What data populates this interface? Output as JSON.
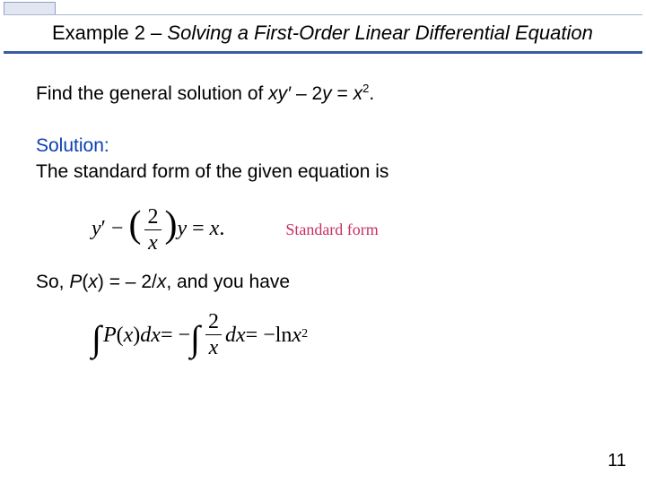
{
  "title": {
    "prefix": "Example 2 –",
    "sub": "Solving a First-Order Linear Differential Equation"
  },
  "prompt": {
    "lead": "Find the general solution of ",
    "lhs1": "xy",
    "prime": "′",
    "mid": " – 2",
    "yv": "y",
    "eq": " = ",
    "xv": "x",
    "exp": "2",
    "dot": "."
  },
  "solution": {
    "label": "Solution:",
    "line1": "The standard form of the given equation is"
  },
  "eq1": {
    "y": "y",
    "prime": "′",
    "minus": " − ",
    "lpar": "(",
    "num": "2",
    "den": "x",
    "rpar": ")",
    "yv": "y",
    "eq": " = ",
    "rhs": "x",
    "dot": ".",
    "annot": "Standard form"
  },
  "so": {
    "lead": "So, ",
    "P": "P",
    "lpar": "(",
    "xv": "x",
    "rpar": ") = – 2/",
    "x2": "x",
    "comma": ", and you have"
  },
  "eq2": {
    "int1": "∫",
    "P": "P",
    "lpar": "(",
    "xv": "x",
    "rpar": ") ",
    "dx1": "dx",
    "eq1": " = −",
    "int2": "∫",
    "num": "2",
    "den": "x",
    "dx2": "dx",
    "eq2": " = −ln ",
    "xr": "x",
    "exp": "2"
  },
  "page": "11"
}
